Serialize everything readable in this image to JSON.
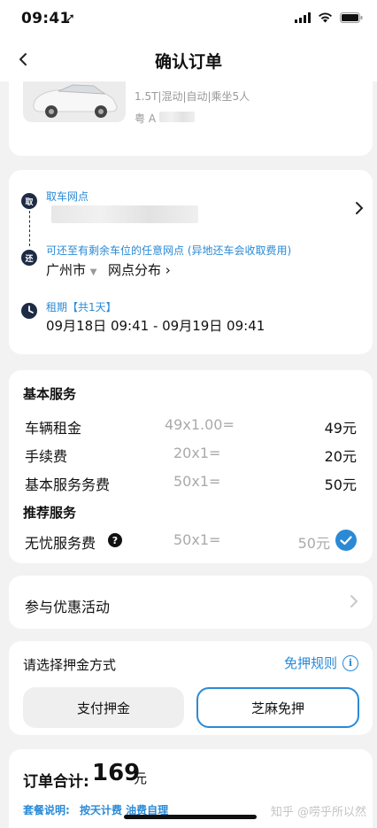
{
  "status_bar": {
    "time": "09:41",
    "location_glyph": "➚",
    "icons": [
      "signal-icon",
      "wifi-icon",
      "battery-icon"
    ]
  },
  "nav": {
    "back_icon": "chevron-left-icon",
    "title": "确认订单"
  },
  "vehicle": {
    "spec": "1.5T|混动|自动|乘坐5人",
    "plate_prefix": "粤 A"
  },
  "route": {
    "pickup": {
      "icon_text": "取",
      "label": "取车网点"
    },
    "return": {
      "icon_text": "还",
      "label": "可还至有剩余车位的任意网点 (异地还车会收取费用)",
      "city": "广州市",
      "network_link": "网点分布"
    },
    "rental": {
      "label": "租期【共1天】",
      "period": "09月18日 09:41 - 09月19日 09:41"
    }
  },
  "services": {
    "basic_heading": "基本服务",
    "basic_items": [
      {
        "name": "车辆租金",
        "formula": "49x1.00=",
        "amount": "49元"
      },
      {
        "name": "手续费",
        "formula": "20x1=",
        "amount": "20元"
      },
      {
        "name": "基本服务务费",
        "formula": "50x1=",
        "amount": "50元"
      }
    ],
    "recommended_heading": "推荐服务",
    "recommended_items": [
      {
        "name": "无忧服务费",
        "formula": "50x1=",
        "amount": "50元",
        "selected": true
      }
    ]
  },
  "promo": {
    "label": "参与优惠活动"
  },
  "deposit": {
    "label": "请选择押金方式",
    "rules_link": "免押规则",
    "options": [
      "支付押金",
      "芝麻免押"
    ],
    "selected": "芝麻免押"
  },
  "total": {
    "label": "订单合计:",
    "value": "169",
    "unit": "元",
    "package_label": "套餐说明:",
    "package_value": "按天计费 油费自理"
  },
  "watermark": "知乎 @唠乎所以然",
  "colors": {
    "accent": "#2a8ad6",
    "route_icon": "#1d2b45",
    "background": "#f2f2f2"
  }
}
